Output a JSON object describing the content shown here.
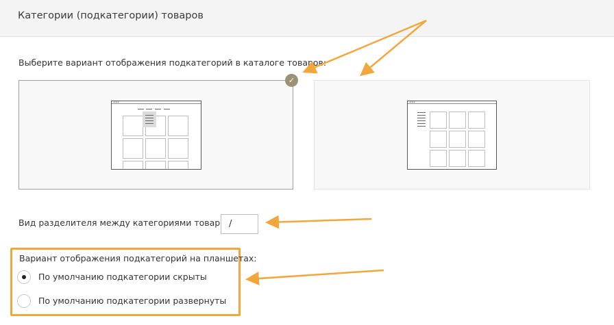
{
  "header": {
    "title": "Категории (подкатегории) товаров"
  },
  "layout_choice": {
    "label": "Выберите вариант отображения подкатегорий в каталоге товаров:",
    "options": [
      {
        "id": "dropdown-menu",
        "selected": true
      },
      {
        "id": "left-sidebar",
        "selected": false
      }
    ],
    "check_icon": "check-icon"
  },
  "separator": {
    "label": "Вид разделителя между категориями товаров:",
    "value": "/"
  },
  "tablet": {
    "label": "Вариант отображения подкатегорий на планшетах:",
    "options": [
      {
        "label": "По умолчанию подкатегории скрыты",
        "checked": true
      },
      {
        "label": "По умолчанию подкатегории развернуты",
        "checked": false
      }
    ]
  },
  "colors": {
    "annotation_orange": "#f2a73c",
    "badge": "#9a9274",
    "header_bg": "#f4f4f4"
  }
}
